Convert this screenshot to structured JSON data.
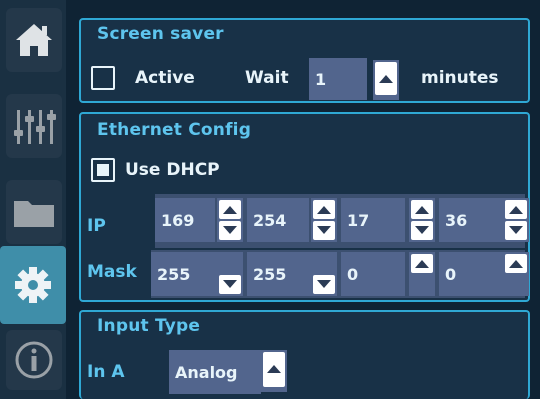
{
  "sidebar": {
    "items": [
      {
        "icon": "home-icon",
        "active": false
      },
      {
        "icon": "sliders-icon",
        "active": false
      },
      {
        "icon": "folder-icon",
        "active": false
      },
      {
        "icon": "gear-icon",
        "active": true
      },
      {
        "icon": "info-icon",
        "active": false
      }
    ]
  },
  "screen_saver": {
    "title": "Screen saver",
    "active_label": "Active",
    "active_checked": false,
    "wait_label": "Wait",
    "wait_value": "1",
    "unit_label": "minutes"
  },
  "ethernet": {
    "title": "Ethernet Config",
    "dhcp_label": "Use DHCP",
    "dhcp_checked": true,
    "ip_label": "IP",
    "ip": [
      "169",
      "254",
      "17",
      "36"
    ],
    "mask_label": "Mask",
    "mask": [
      "255",
      "255",
      "0",
      "0"
    ]
  },
  "input_type": {
    "title": "Input Type",
    "input_label": "In A",
    "input_value": "Analog"
  },
  "colors": {
    "accent": "#5ec5ee",
    "panel_border": "#2fa8d4",
    "field": "#52658d",
    "active_nav": "#3f8ea9"
  }
}
